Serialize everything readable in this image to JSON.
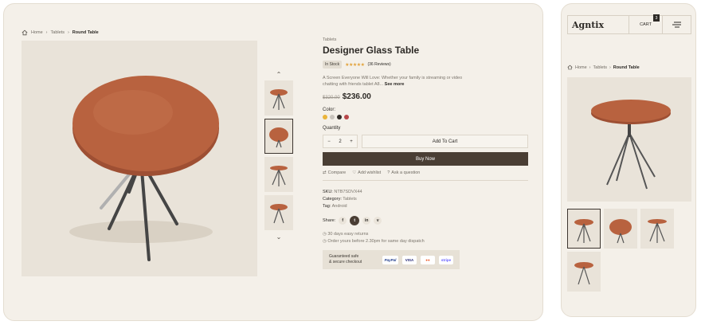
{
  "breadcrumb": {
    "home": "Home",
    "category": "Tablets",
    "current": "Round Table"
  },
  "product": {
    "category": "Tablets",
    "title": "Designer Glass Table",
    "stock": "In Stock",
    "stars": "★★★★★",
    "reviews": "(36 Reviews)",
    "description": "A Screen Everyone Will Love: Whether your family is streaming or video chatting with friends tablet A8...",
    "see_more": "See more",
    "old_price": "$320.00",
    "price": "$236.00",
    "color_label": "Color:",
    "colors": [
      "#eab43a",
      "#c9c4bd",
      "#2f2a26",
      "#b8474a"
    ],
    "quantity_label": "Quantity",
    "quantity": "2",
    "minus": "−",
    "plus": "+",
    "add_to_cart": "Add To Cart",
    "buy_now": "Buy Now",
    "compare": "Compare",
    "wishlist": "Add wishlist",
    "ask": "Ask a question",
    "sku_label": "SKU:",
    "sku": "NTB7SDVX44",
    "category_label": "Category:",
    "category_value": "Tablets",
    "tag_label": "Tag:",
    "tag_value": "Android",
    "share_label": "Share:",
    "share_icons": [
      "f",
      "t",
      "in",
      "v"
    ],
    "returns": "30 days easy returns",
    "dispatch": "Order yours before 2.30pm for same day dispatch",
    "secure_line1": "Guaranteed safe",
    "secure_line2": "& secure checkout",
    "payments": [
      "PayPal",
      "VISA",
      "●●",
      "stripe"
    ]
  },
  "mobile": {
    "logo": "Agntix",
    "cart_label": "CART",
    "cart_count": "3",
    "breadcrumb": {
      "home": "Home",
      "category": "Tablets",
      "current": "Round Table"
    }
  },
  "nav": {
    "up": "⌃",
    "down": "⌄"
  },
  "colors": {
    "accent": "#4a3e34",
    "background": "#f4f0e9",
    "wood": "#b8623f"
  }
}
